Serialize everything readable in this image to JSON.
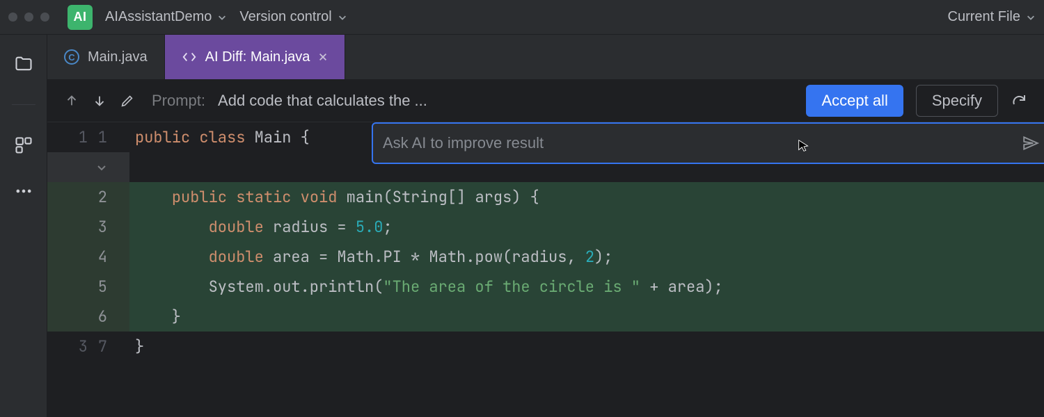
{
  "menubar": {
    "ai_badge": "AI",
    "project_name": "AIAssistantDemo",
    "version_control_label": "Version control",
    "execution_target": "Current File"
  },
  "tabs": [
    {
      "icon": "circle-c",
      "label": "Main.java",
      "active": false,
      "closable": false
    },
    {
      "icon": "diff",
      "label": "AI Diff: Main.java",
      "active": true,
      "closable": true
    }
  ],
  "diff_toolbar": {
    "prompt_label": "Prompt:",
    "prompt_text": "Add code that calculates the ...",
    "accept_label": "Accept all",
    "specify_label": "Specify"
  },
  "ask_popup": {
    "placeholder": "Ask AI to improve result"
  },
  "gutter": {
    "rows": [
      {
        "left": "1",
        "right": "1",
        "hl": false,
        "collapse": false
      },
      {
        "left": "",
        "right": "",
        "hl": false,
        "collapse": true,
        "arrow": true
      },
      {
        "left": "",
        "right": "2",
        "hl": true,
        "collapse": false
      },
      {
        "left": "",
        "right": "3",
        "hl": true,
        "collapse": false
      },
      {
        "left": "",
        "right": "4",
        "hl": true,
        "collapse": false
      },
      {
        "left": "",
        "right": "5",
        "hl": true,
        "collapse": false
      },
      {
        "left": "",
        "right": "6",
        "hl": true,
        "collapse": false
      },
      {
        "left": "3",
        "right": "7",
        "hl": false,
        "collapse": false
      }
    ]
  },
  "code_lines": [
    {
      "hl": false,
      "tokens": [
        {
          "t": "kw",
          "v": "public "
        },
        {
          "t": "kw",
          "v": "class "
        },
        {
          "t": "ident",
          "v": "Main "
        },
        {
          "t": "punct",
          "v": "{"
        }
      ]
    },
    {
      "hl": false,
      "tokens": [
        {
          "t": "punct",
          "v": ""
        }
      ]
    },
    {
      "hl": true,
      "tokens": [
        {
          "t": "punct",
          "v": "    "
        },
        {
          "t": "kw",
          "v": "public "
        },
        {
          "t": "kw",
          "v": "static "
        },
        {
          "t": "kw",
          "v": "void "
        },
        {
          "t": "fn",
          "v": "main"
        },
        {
          "t": "punct",
          "v": "(String[] args) {"
        }
      ]
    },
    {
      "hl": true,
      "tokens": [
        {
          "t": "punct",
          "v": "        "
        },
        {
          "t": "kw",
          "v": "double "
        },
        {
          "t": "ident",
          "v": "radius = "
        },
        {
          "t": "num",
          "v": "5.0"
        },
        {
          "t": "semi",
          "v": ";"
        }
      ]
    },
    {
      "hl": true,
      "tokens": [
        {
          "t": "punct",
          "v": "        "
        },
        {
          "t": "kw",
          "v": "double "
        },
        {
          "t": "ident",
          "v": "area = Math.PI * Math.pow(radius, "
        },
        {
          "t": "num",
          "v": "2"
        },
        {
          "t": "ident",
          "v": ")"
        },
        {
          "t": "semi",
          "v": ";"
        }
      ]
    },
    {
      "hl": true,
      "tokens": [
        {
          "t": "punct",
          "v": "        System.out.println("
        },
        {
          "t": "str",
          "v": "\"The area of the circle is \""
        },
        {
          "t": "ident",
          "v": " + area)"
        },
        {
          "t": "semi",
          "v": ";"
        }
      ]
    },
    {
      "hl": true,
      "tokens": [
        {
          "t": "punct",
          "v": "    }"
        }
      ]
    },
    {
      "hl": false,
      "tokens": [
        {
          "t": "punct",
          "v": "}"
        }
      ]
    }
  ]
}
